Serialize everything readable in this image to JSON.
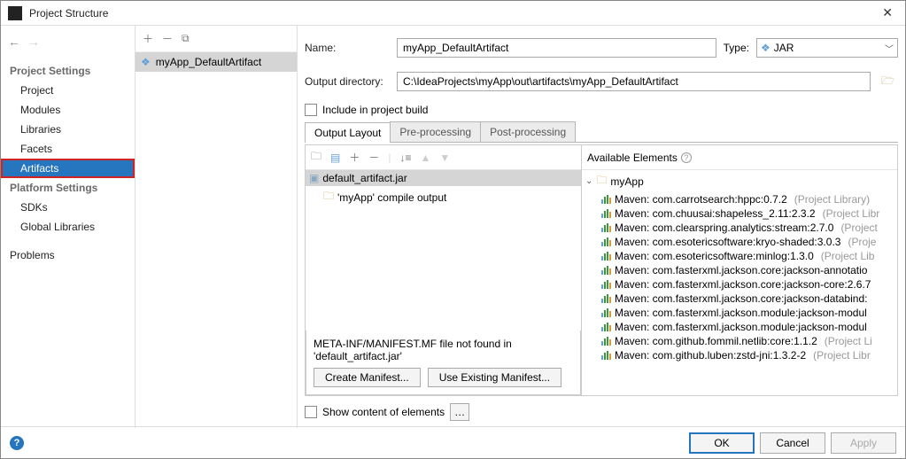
{
  "window": {
    "title": "Project Structure"
  },
  "sidebar": {
    "section1": "Project Settings",
    "items1": [
      "Project",
      "Modules",
      "Libraries",
      "Facets",
      "Artifacts"
    ],
    "section2": "Platform Settings",
    "items2": [
      "SDKs",
      "Global Libraries"
    ],
    "problems": "Problems"
  },
  "artifactList": {
    "selected": "myApp_DefaultArtifact"
  },
  "form": {
    "nameLabel": "Name:",
    "nameValue": "myApp_DefaultArtifact",
    "typeLabel": "Type:",
    "typeValue": "JAR",
    "outDirLabel": "Output directory:",
    "outDirValue": "C:\\IdeaProjects\\myApp\\out\\artifacts\\myApp_DefaultArtifact",
    "includeLabel": "Include in project build"
  },
  "tabs": [
    "Output Layout",
    "Pre-processing",
    "Post-processing"
  ],
  "layout": {
    "root": "default_artifact.jar",
    "child": "'myApp' compile output",
    "availableHeader": "Available Elements",
    "rootModule": "myApp",
    "libs": [
      {
        "t": "Maven: com.carrotsearch:hppc:0.7.2",
        "s": "(Project Library)"
      },
      {
        "t": "Maven: com.chuusai:shapeless_2.11:2.3.2",
        "s": "(Project Libr"
      },
      {
        "t": "Maven: com.clearspring.analytics:stream:2.7.0",
        "s": "(Project"
      },
      {
        "t": "Maven: com.esotericsoftware:kryo-shaded:3.0.3",
        "s": "(Proje"
      },
      {
        "t": "Maven: com.esotericsoftware:minlog:1.3.0",
        "s": "(Project Lib"
      },
      {
        "t": "Maven: com.fasterxml.jackson.core:jackson-annotatio",
        "s": ""
      },
      {
        "t": "Maven: com.fasterxml.jackson.core:jackson-core:2.6.7",
        "s": ""
      },
      {
        "t": "Maven: com.fasterxml.jackson.core:jackson-databind:",
        "s": ""
      },
      {
        "t": "Maven: com.fasterxml.jackson.module:jackson-modul",
        "s": ""
      },
      {
        "t": "Maven: com.fasterxml.jackson.module:jackson-modul",
        "s": ""
      },
      {
        "t": "Maven: com.github.fommil.netlib:core:1.1.2",
        "s": "(Project Li"
      },
      {
        "t": "Maven: com.github.luben:zstd-jni:1.3.2-2",
        "s": "(Project Libr"
      }
    ]
  },
  "manifest": {
    "msg": "META-INF/MANIFEST.MF file not found in 'default_artifact.jar'",
    "createBtn": "Create Manifest...",
    "useBtn": "Use Existing Manifest..."
  },
  "bottom": {
    "showContent": "Show content of elements"
  },
  "footer": {
    "ok": "OK",
    "cancel": "Cancel",
    "apply": "Apply"
  }
}
